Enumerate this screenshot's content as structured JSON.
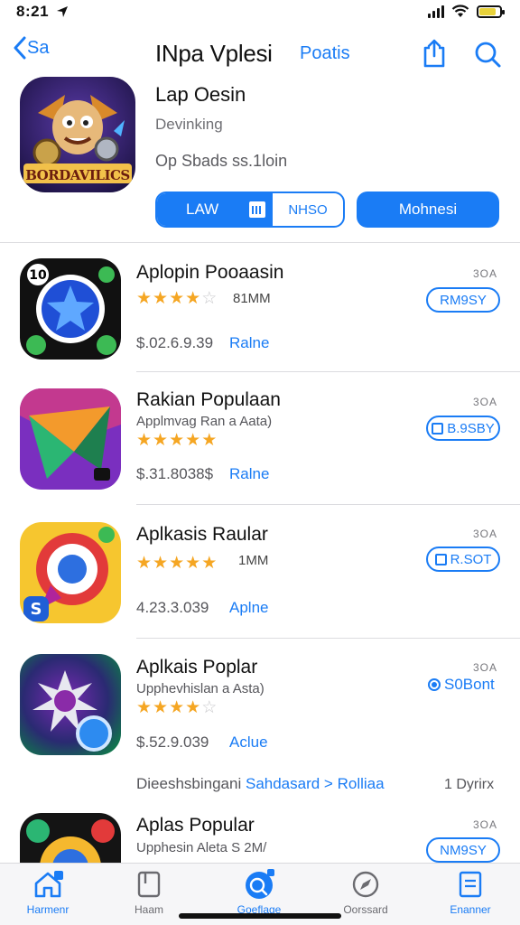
{
  "status_bar": {
    "time": "8:21",
    "battery_color": "#e8d23a"
  },
  "nav": {
    "back_label": "Sa",
    "title": "INpa Vplesi",
    "link_label": "Poatis",
    "share_icon": "share-icon",
    "search_icon": "search-icon"
  },
  "hero": {
    "icon_text": "BORDAVILICS",
    "name": "Lap Oesin",
    "subtitle": "Devinking",
    "meta": "Op Sbads ss.1loin",
    "seg_left_label": "LAW",
    "seg_right_label": "NHSO",
    "primary_button": "Mohnesi"
  },
  "apps": [
    {
      "title": "Aplopin Pooaasin",
      "subtitle": "",
      "rating": 4,
      "count": "81MM",
      "price": "$.02.6.9.39",
      "link": "Ralne",
      "size": "3OA",
      "button": "RM9SY",
      "button_style": "outline"
    },
    {
      "title": "Rakian Populaan",
      "subtitle": "Applmvag Ran a Aata)",
      "rating": 4.5,
      "count": "",
      "price": "$.31.8038$",
      "link": "Ralne",
      "size": "3OA",
      "button": "B.9SBY",
      "button_style": "outline-cal"
    },
    {
      "title": "Aplkasis Raular",
      "subtitle": "",
      "rating": 4.5,
      "count": "1MM",
      "price": "4.23.3.039",
      "link": "Aplne",
      "size": "3OA",
      "button": "R.SOT",
      "button_style": "outline-cal"
    },
    {
      "title": "Aplkais Poplar",
      "subtitle": "Upphevhislan a Asta)",
      "rating": 4,
      "count": "",
      "price": "$.52.9.039",
      "link": "Aclue",
      "size": "3OA",
      "button": "S0Bont",
      "button_style": "plain"
    },
    {
      "title": "Aplas Popular",
      "subtitle": "Upphesin Aleta S 2M/",
      "rating": 0,
      "count": "",
      "price": "",
      "link": "",
      "size": "3OA",
      "button": "NM9SY",
      "button_style": "outline"
    }
  ],
  "footer": {
    "prefix": "Dieeshsbingani",
    "link": "Sahdasard > Rolliaa",
    "right": "1 Dyrirx"
  },
  "tabs": [
    {
      "label": "Harmenr",
      "icon": "home-icon",
      "active": true
    },
    {
      "label": "Haam",
      "icon": "bookmark-icon",
      "active": false
    },
    {
      "label": "Goeflage",
      "icon": "games-icon",
      "active": true
    },
    {
      "label": "Oorssard",
      "icon": "compass-icon",
      "active": false
    },
    {
      "label": "Enanner",
      "icon": "document-icon",
      "active": true
    }
  ]
}
